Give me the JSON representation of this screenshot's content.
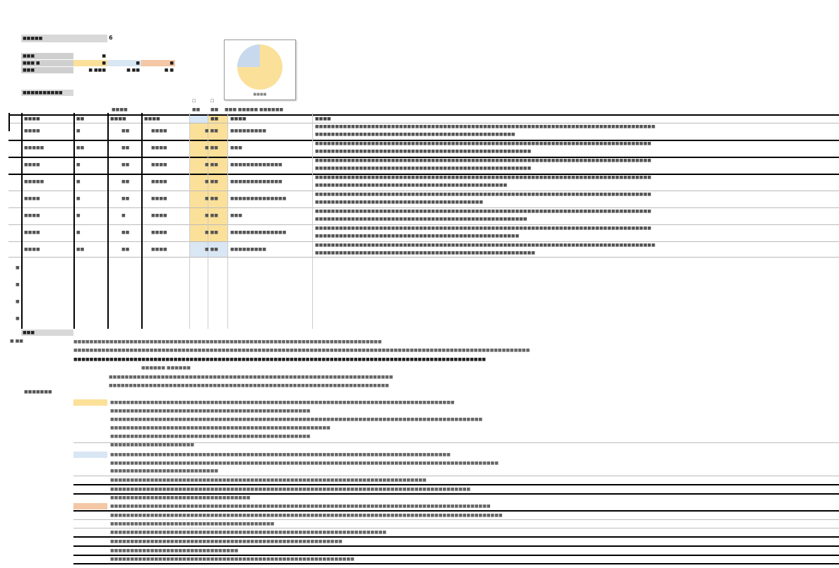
{
  "summary": {
    "title": "■■■■■",
    "value": "6",
    "rows": [
      {
        "label": "■■■",
        "cells": [
          "",
          "■",
          "",
          ""
        ]
      },
      {
        "label": "■■■ ■",
        "cells": [
          "■",
          "■",
          "■"
        ]
      },
      {
        "label": "■■■",
        "cells": [
          "■.■■■",
          "■.■■",
          "■.■"
        ]
      }
    ],
    "subheading": "■■■■■■■■■■"
  },
  "pie": {
    "caption": "■■■■",
    "slices": [
      {
        "label": "yellow",
        "value": 0.75,
        "color": "#fbe09a"
      },
      {
        "label": "blue",
        "value": 0.25,
        "color": "#c8d9ee"
      }
    ]
  },
  "colors": {
    "yellow": "#fbe09a",
    "blue": "#d9e6f4",
    "orange": "#f4c7a6"
  },
  "table": {
    "top_label": "■■■■",
    "checkbox_labels": [
      "■■",
      "■■"
    ],
    "header_extra": "■■■ ■■■■■ ■■■■■■",
    "headers": [
      "■■■■",
      "■■",
      "■■■■",
      "■■■■",
      "■■",
      "■■■■",
      "■■■■"
    ],
    "rows": [
      {
        "c1": "■■■■",
        "c2": "■",
        "c3": "■■",
        "c4": "■■■■",
        "c5": "■ ■■",
        "c6": "■■■■■■■■■",
        "c7": "■■■■■■■■■■■■■■■■■■■■■■■■■■■■■■■■■■■■■■■■■■■■■■■■■■■■■■■■■■■■■■■■■■■■■■■■■■■■■■■■■■■■■",
        "c7b": "■■■■■■■■■■■■■■■■■■■■■■■■■■■■■■■■■■■■■■■■■■■■■■■■■■",
        "tone": "yellow"
      },
      {
        "c1": "■■■■■",
        "c2": "■■",
        "c3": "■■",
        "c4": "■■■■",
        "c5": "■ ■■",
        "c6": "■■■",
        "c7": "■■■■■■■■■■■■■■■■■■■■■■■■■■■■■■■■■■■■■■■■■■■■■■■■■■■■■■■■■■■■■■■■■■■■■■■■■■■■■■■■■■■■",
        "c7b": "■■■■■■■■■■■■■■■■■■■■■■■■■■■■■■■■■■■■■■■■■■■■■■■■■■■■■■",
        "tone": "yellow"
      },
      {
        "c1": "■■■■",
        "c2": "■",
        "c3": "■■",
        "c4": "■■■■",
        "c5": "■ ■■",
        "c6": "■■■■■■■■■■■■■",
        "c7": "■■■■■■■■■■■■■■■■■■■■■■■■■■■■■■■■■■■■■■■■■■■■■■■■■■■■■■■■■■■■■■■■■■■■■■■■■■■■■■■■■■■■",
        "c7b": "■■■■■■■■■■■■■■■■■■■■■■■■■■■■■■■■■■■■■■■■■■■■■■■■■■■■■■",
        "tone": "yellow"
      },
      {
        "c1": "■■■■■",
        "c2": "■",
        "c3": "■■",
        "c4": "■■■■",
        "c5": "■ ■■",
        "c6": "■■■■■■■■■■■■■",
        "c7": "■■■■■■■■■■■■■■■■■■■■■■■■■■■■■■■■■■■■■■■■■■■■■■■■■■■■■■■■■■■■■■■■■■■■■■■■■■■■■■■■■■■■",
        "c7b": "■■■■■■■■■■■■■■■■■■■■■■■■■■■■■■■■■■■■■■■■■■■■■■■■",
        "tone": "yellow"
      },
      {
        "c1": "■■■■",
        "c2": "■",
        "c3": "■■",
        "c4": "■■■■",
        "c5": "■ ■■",
        "c6": "■■■■■■■■■■■■■■",
        "c7": "■■■■■■■■■■■■■■■■■■■■■■■■■■■■■■■■■■■■■■■■■■■■■■■■■■■■■■■■■■■■■■■■■■■■■■■■■■■■■■■■■■■■",
        "c7b": "■■■■■■■■■■■■■■■■■■■■■■■■■■■■■■■■■■■■■■■■■■",
        "tone": "yellow"
      },
      {
        "c1": "■■■■",
        "c2": "■",
        "c3": "■",
        "c4": "■■■■",
        "c5": "■ ■■",
        "c6": "■■■",
        "c7": "■■■■■■■■■■■■■■■■■■■■■■■■■■■■■■■■■■■■■■■■■■■■■■■■■■■■■■■■■■■■■■■■■■■■■■■■■■■■■■■■■■■■",
        "c7b": "■■■■■■■■■■■■■■■■■■■■■■■■■■■■■■■■■■■■■■■■■■■■■■■■■■■■■",
        "tone": "yellow"
      },
      {
        "c1": "■■■■",
        "c2": "■",
        "c3": "■■",
        "c4": "■■■■",
        "c5": "■ ■■",
        "c6": "■■■■■■■■■■■■■■",
        "c7": "■■■■■■■■■■■■■■■■■■■■■■■■■■■■■■■■■■■■■■■■■■■■■■■■■■■■■■■■■■■■■■■■■■■■■■■■■■■■■■■■■■■■",
        "c7b": "■■■■■■■■■■■■■■■■■■■■■■■■■■■■■■■■■■■■■■■■■■■■■■■■■■■",
        "tone": "yellow"
      },
      {
        "c1": "■■■■",
        "c2": "■■",
        "c3": "■■",
        "c4": "■■■■",
        "c5": "■ ■■",
        "c6": "■■■■■■■■■",
        "c7": "■■■■■■■■■■■■■■■■■■■■■■■■■■■■■■■■■■■■■■■■■■■■■■■■■■■■■■■■■■■■■■■■■■■■■■■■■■■■■■■■■■■■■",
        "c7b": "■■■■■■■■■■■■■■■■■■■■■■■■■■■■■■■■■■■■■■■■■■■■■■■■■■■■■■■",
        "tone": "blue"
      }
    ],
    "empty_row_markers": [
      "■",
      "■",
      "■",
      "■"
    ],
    "footer_label": "■■■"
  },
  "notes": {
    "side_label_1": "■ ■■",
    "side_label_2": "■■■■■■■",
    "lines_top": [
      "■■■■■■■■■■■■■■■■■■■■■■■■■■■■■■■■■■■■■■■■■■■■■■■■■■■■■■■■■■■■■■■■■■■■■■■■■■■■■",
      "■■■■■■■■■■■■■■■■■■■■■■■■■■■■■■■■■■■■■■■■■■■■■■■■■■■■■■■■■■■■■■■■■■■■■■■■■■■■■■■■■■■■■■■■■■■■■■■■■■■■■■■■■■■■■■■■■■",
      "■■■■■■■■■■■■■■■■■■■■■■■■■■■■■■■■■■■■■■■■■■■■■■■■■■■■■■■■■■■■■■■■■■■■■■■■■■■■■■■■■■■■■■■■■■■■■■■■■■■■■■■",
      "■■■■■■               ■■■■■■",
      "■■■■■■■■■■■■■■■■■■■■■■■■■■■■■■■■■■■■■■■■■■■■■■■■■■■■■■■■■■■■■■■■■■■■■■■",
      "■■■■■■■■■■■■■■■■■■■■■■■■■■■■■■■■■■■■■■■■■■■■■■■■■■■■■■■■■■■■■■■■■■■■■■"
    ],
    "yellow_lines": [
      "■■■■■■■■■■■■■■■■■■■■■■■■■■■■■■■■■■■■■■■■■■■■■■■■■■■■■■■■■■■■■■■■■■■■■■■■■■■■■■■■■■■■■■",
      "■■■■■■■■■■■■■■■■■■■■■■■■■■■■■■■■■■■■■■■■■■■■■■■■■■",
      "■■■■■■■■■■■■■■■■■■■■■■■■■■■■■■■■■■■■■■■■■■■■■■■■■■■■■■■■■■■■■■■■■■■■■■■■■■■■■■■■■■■■■■■■■■■■■",
      "■■■■■■■■■■■■■■■■■■■■■■■■■■■■■■■■■■■■■■■■■■■■■■■■■■■■■■■",
      "■■■■■■■■■■■■■■■■■■■■■■■■■■■■■■■■■■■■■■■■■■■■■■■■■■",
      "■■■■■■■■■■■■■■■■■■■■■"
    ],
    "blue_lines": [
      "■■■■■■■■■■■■■■■■■■■■■■■■■■■■■■■■■■■■■■■■■■■■■■■■■■■■■■■■■■■■■■■■■■■■■■■■■■■■■■■■■■■■■",
      "■■■■■■■■■■■■■■■■■■■■■■■■■■■■■■■■■■■■■■■■■■■■■■■■■■■■■■■■■■■■■■■■■■■■■■■■■■■■■■■■■■■■■■■■■■■■■■■■■",
      "                      ■■■■■■■■■■■■■■■■■■■■■■■■■■■",
      "■■■■■■■■■■■■■■■■■■■■■■■■■■■■■■■■■■■■■■■■■■■■■■■■■■■■■■■■■■■■■■■■■■■■■■■■■■■■■■■",
      "■■■■■■■■■■■■■■■■■■■■■■■■■■■■■■■■■■■■■■■■■■■■■■■■■■■■■■■■■■■■■■■■■■■■■■■■■■■■■■■■■■■■■■■■■■",
      "■■■■■■■■■■■■■■■■■■■■■■■■■■■■■■■■■■■"
    ],
    "orange_lines": [
      "■■■■■■■■■■■■■■■■■■■■■■■■■■■■■■■■■■■■■■■■■■■■■■■■■■■■■■■■■■■■■■■■■■■■■■■■■■■■■■■■■■■■■■■■■■■■■■■",
      "■■■■■■■■■■■■■■■■■■■■■■■■■■■■■■■■■■■■■■■■■■■■■■■■■■■■■■■■■■■■■■■■■■■■■■■■■■■■■■■■■■■■■■■■■■■■■■■■■■",
      "■■■■■■■■■■■■■■■■■■■■■■■■■■■■■■■■■■■■■■■■■",
      "■■■■■■■■■■■■■■■■■■■■■■■■■■■■■■■■■■■■■■■■■■■■■■■■■■■■■■■■■■■■■■■■■■■■■",
      "■■■■■■■■■■■■■■■■■■■■■■■■■■■■■■■■■■■■■■■■■■■■■■■■■■■■■■■■■■",
      "■■■■■■■■■■■■■■■■■■■■■■■■■■■■■■■■",
      "■■■■■■■■■■■■■■■■■■■■■■■■■■■■■■■■■■■■■■■■■■■■■■■■■■■■■■■■■■■■■"
    ]
  }
}
